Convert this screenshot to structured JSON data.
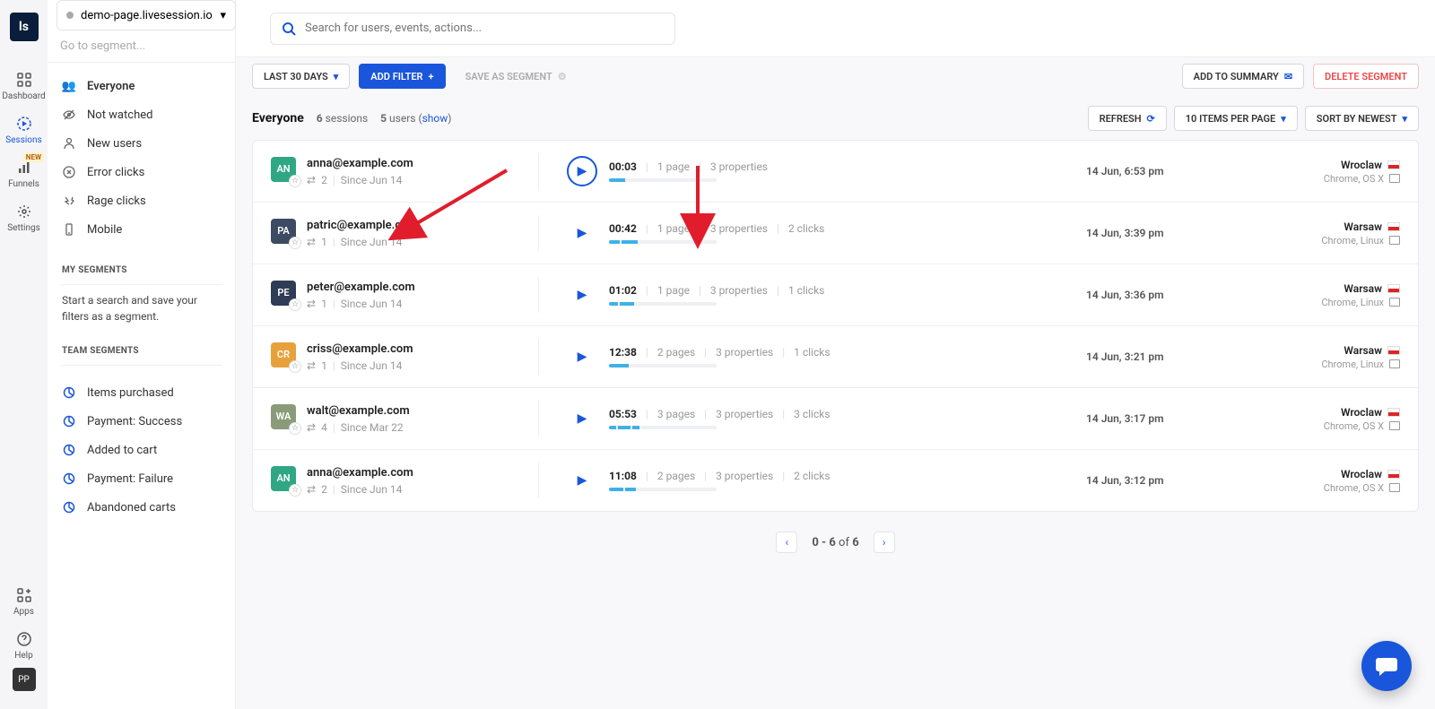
{
  "brand": "ls",
  "nav": {
    "dashboard": "Dashboard",
    "sessions": "Sessions",
    "funnels": "Funnels",
    "settings": "Settings",
    "apps": "Apps",
    "help": "Help",
    "new_badge": "NEW",
    "pp": "PP"
  },
  "header": {
    "site": "demo-page.livesession.io",
    "search_placeholder": "Search for users, events, actions...",
    "segment_placeholder": "Go to segment..."
  },
  "toolbar": {
    "date_range": "LAST 30 DAYS",
    "add_filter": "ADD FILTER",
    "save_segment": "SAVE AS SEGMENT",
    "add_summary": "ADD TO SUMMARY",
    "delete_segment": "DELETE SEGMENT"
  },
  "segments": {
    "everyone": "Everyone",
    "not_watched": "Not watched",
    "new_users": "New users",
    "error_clicks": "Error clicks",
    "rage_clicks": "Rage clicks",
    "mobile": "Mobile",
    "my_heading": "MY SEGMENTS",
    "my_text": "Start a search and save your filters as a segment.",
    "team_heading": "TEAM SEGMENTS",
    "team": {
      "items_purchased": "Items purchased",
      "payment_success": "Payment: Success",
      "added_cart": "Added to cart",
      "payment_failure": "Payment: Failure",
      "abandoned": "Abandoned carts"
    }
  },
  "list": {
    "title": "Everyone",
    "sessions_count": "6",
    "sessions_label": " sessions",
    "users_count": "5",
    "users_label": " users (",
    "show": "show",
    "close_paren": ")",
    "refresh": "REFRESH",
    "per_page": "10 ITEMS PER PAGE",
    "sort": "SORT BY NEWEST"
  },
  "rows": [
    {
      "avTxt": "AN",
      "avBg": "#2fa784",
      "email": "anna@example.com",
      "sessions": "2",
      "since": "Since Jun 14",
      "dur": "00:03",
      "pages": "1 page",
      "props": "3 properties",
      "clicks": "",
      "time": "14 Jun, 6:53 pm",
      "city": "Wroclaw",
      "sys": "Chrome, OS X",
      "bars": [
        18
      ]
    },
    {
      "avTxt": "PA",
      "avBg": "#3c4a63",
      "email": "patric@example.com",
      "sessions": "1",
      "since": "Since Jun 14",
      "dur": "00:42",
      "pages": "1 page",
      "props": "3 properties",
      "clicks": "2 clicks",
      "time": "14 Jun, 3:39 pm",
      "city": "Warsaw",
      "sys": "Chrome, Linux",
      "bars": [
        12,
        18
      ]
    },
    {
      "avTxt": "PE",
      "avBg": "#2e3c55",
      "email": "peter@example.com",
      "sessions": "1",
      "since": "Since Jun 14",
      "dur": "01:02",
      "pages": "1 page",
      "props": "3 properties",
      "clicks": "1 clicks",
      "time": "14 Jun, 3:36 pm",
      "city": "Warsaw",
      "sys": "Chrome, Linux",
      "bars": [
        10,
        16
      ]
    },
    {
      "avTxt": "CR",
      "avBg": "#e8a13a",
      "email": "criss@example.com",
      "sessions": "1",
      "since": "Since Jun 14",
      "dur": "12:38",
      "pages": "2 pages",
      "props": "3 properties",
      "clicks": "1 clicks",
      "time": "14 Jun, 3:21 pm",
      "city": "Warsaw",
      "sys": "Chrome, Linux",
      "bars": [
        22
      ]
    },
    {
      "avTxt": "WA",
      "avBg": "#8a9b7a",
      "email": "walt@example.com",
      "sessions": "4",
      "since": "Since Mar 22",
      "dur": "05:53",
      "pages": "3 pages",
      "props": "3 properties",
      "clicks": "3 clicks",
      "time": "14 Jun, 3:17 pm",
      "city": "Wroclaw",
      "sys": "Chrome, OS X",
      "bars": [
        8,
        14,
        8
      ]
    },
    {
      "avTxt": "AN",
      "avBg": "#2fa784",
      "email": "anna@example.com",
      "sessions": "2",
      "since": "Since Jun 14",
      "dur": "11:08",
      "pages": "2 pages",
      "props": "3 properties",
      "clicks": "2 clicks",
      "time": "14 Jun, 3:12 pm",
      "city": "Wroclaw",
      "sys": "Chrome, OS X",
      "bars": [
        16,
        12
      ]
    }
  ],
  "pager": {
    "range": "0 - 6",
    "of": " of ",
    "total": "6"
  }
}
